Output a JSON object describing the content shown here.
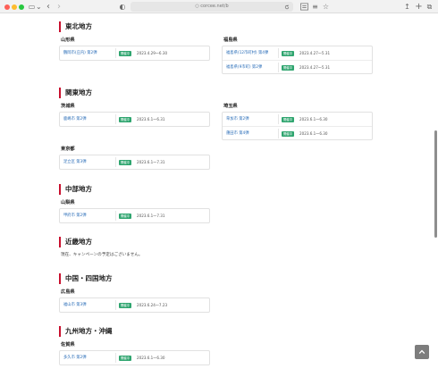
{
  "browser": {
    "url": "○ corcee.net/b",
    "icons": [
      "sidebar-icon",
      "chevron-down-icon",
      "back-icon",
      "forward-icon",
      "shield-icon",
      "translate-icon",
      "reader-icon",
      "bookmark-icon",
      "refresh-icon",
      "share-icon",
      "new-tab-icon",
      "tabs-icon"
    ],
    "glyphs": {
      "sidebar": "▭",
      "chevron": "⌄",
      "back": "‹",
      "forward": "›",
      "shield": "◐",
      "share": "↥",
      "new_tab": "+",
      "tabs": "⧉",
      "bookmark": "☆",
      "reader": "≡"
    }
  },
  "status_label": "開催中",
  "accent_color": "#c8102e",
  "badge_color": "#2fa56f",
  "regions": {
    "tohoku": {
      "title": "東北地方",
      "yamagata": {
        "name": "山形県",
        "items": [
          {
            "name": "鶴岡市(庄内) 第2弾",
            "period": "2023.4.29〜6.30"
          }
        ]
      },
      "fukushima": {
        "name": "福島県",
        "items": [
          {
            "name": "福島県(12市町村) 第4弾",
            "period": "2023.4.27〜5.31"
          },
          {
            "name": "福島県(9市町) 第2弾",
            "period": "2023.4.27〜5.31"
          }
        ]
      }
    },
    "kanto": {
      "title": "関東地方",
      "ibaraki": {
        "name": "茨城県",
        "items": [
          {
            "name": "鹿嶋市 第2弾",
            "period": "2023.6.1〜6.31"
          }
        ]
      },
      "saitama": {
        "name": "埼玉県",
        "items": [
          {
            "name": "草加市 第2弾",
            "period": "2023.6.1〜6.30"
          },
          {
            "name": "蓮田市 第4弾",
            "period": "2023.6.1〜6.30"
          }
        ]
      },
      "tokyo": {
        "name": "東京都",
        "items": [
          {
            "name": "足立区 第3弾",
            "period": "2023.6.1〜7.31"
          }
        ]
      }
    },
    "chubu": {
      "title": "中部地方",
      "yamanashi": {
        "name": "山梨県",
        "items": [
          {
            "name": "甲府市 第2弾",
            "period": "2023.6.1〜7.31"
          }
        ]
      }
    },
    "kinki": {
      "title": "近畿地方",
      "note": "現在、キャンペーンの予定はございません。"
    },
    "chugoku": {
      "title": "中国・四国地方",
      "hiroshima": {
        "name": "広島県",
        "items": [
          {
            "name": "福山市 第3弾",
            "period": "2023.6.24〜7.23"
          }
        ]
      }
    },
    "kyushu": {
      "title": "九州地方・沖縄",
      "saga": {
        "name": "佐賀県",
        "items": [
          {
            "name": "多久市 第2弾",
            "period": "2023.6.1〜6.30"
          }
        ]
      }
    }
  }
}
